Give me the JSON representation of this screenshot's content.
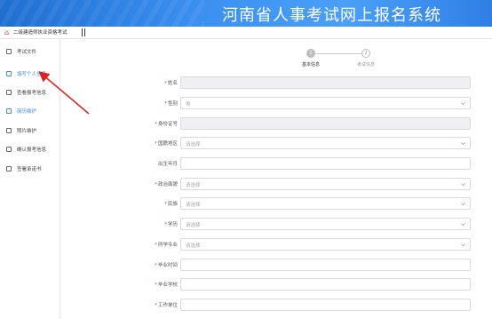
{
  "banner": {
    "title": "河南省人事考试网上报名系统"
  },
  "topbar": {
    "exam_name": "二级建造师执业资格考试"
  },
  "sidebar": {
    "items": [
      {
        "label": "考试文件",
        "icon": "document-icon",
        "active": false
      },
      {
        "label": "填写个人信息",
        "icon": "user-card-icon",
        "active": true
      },
      {
        "label": "查看报考信息",
        "icon": "profile-icon",
        "active": false
      },
      {
        "label": "简历维护",
        "icon": "resume-icon",
        "active": true
      },
      {
        "label": "照片维护",
        "icon": "photo-icon",
        "active": false
      },
      {
        "label": "确认报考信息",
        "icon": "confirm-icon",
        "active": false
      },
      {
        "label": "签署承诺书",
        "icon": "sign-icon",
        "active": false
      }
    ]
  },
  "steps": [
    {
      "num": "1",
      "label": "基本信息",
      "state": "done"
    },
    {
      "num": "2",
      "label": "考试信息",
      "state": "todo"
    }
  ],
  "form": {
    "fields": [
      {
        "label": "姓名",
        "required": true,
        "type": "text",
        "value": "",
        "disabled": true
      },
      {
        "label": "性别",
        "required": true,
        "type": "select",
        "value": "男",
        "disabled": false
      },
      {
        "label": "身份证号",
        "required": true,
        "type": "text",
        "value": "",
        "disabled": true
      },
      {
        "label": "国籍地区",
        "required": true,
        "type": "select",
        "value": "请选择",
        "disabled": false
      },
      {
        "label": "出生年月",
        "required": false,
        "type": "text",
        "value": "",
        "disabled": false
      },
      {
        "label": "政治面貌",
        "required": true,
        "type": "select",
        "value": "请选择",
        "disabled": false
      },
      {
        "label": "民族",
        "required": true,
        "type": "select",
        "value": "请选择",
        "disabled": false
      },
      {
        "label": "学历",
        "required": true,
        "type": "select",
        "value": "请选择",
        "disabled": false
      },
      {
        "label": "所学专业",
        "required": true,
        "type": "select",
        "value": "请选择",
        "disabled": false
      },
      {
        "label": "毕业时间",
        "required": true,
        "type": "text",
        "value": "",
        "disabled": false
      },
      {
        "label": "毕业学校",
        "required": true,
        "type": "text",
        "value": "",
        "disabled": false
      },
      {
        "label": "工作单位",
        "required": true,
        "type": "text",
        "value": "",
        "disabled": false
      }
    ]
  },
  "colors": {
    "accent": "#3b8ff0",
    "banner": "#2f80e6",
    "arrow": "#e02020"
  }
}
